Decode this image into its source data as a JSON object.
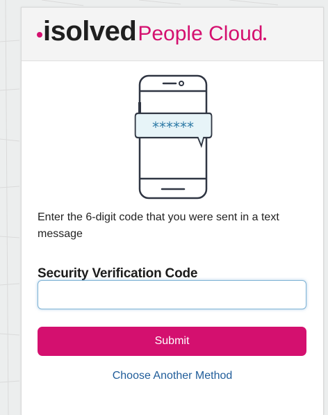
{
  "brand": {
    "name_bold": "isolved",
    "name_light": "People Cloud",
    "accent_color": "#d4106f"
  },
  "illustration": {
    "icon": "phone-sms-code-icon",
    "bubble_text": "******"
  },
  "instruction_text": "Enter the 6-digit code that you were sent in a text message",
  "form": {
    "label": "Security Verification Code",
    "input_value": "",
    "input_placeholder": "",
    "submit_label": "Submit",
    "alt_method_label": "Choose Another Method"
  }
}
